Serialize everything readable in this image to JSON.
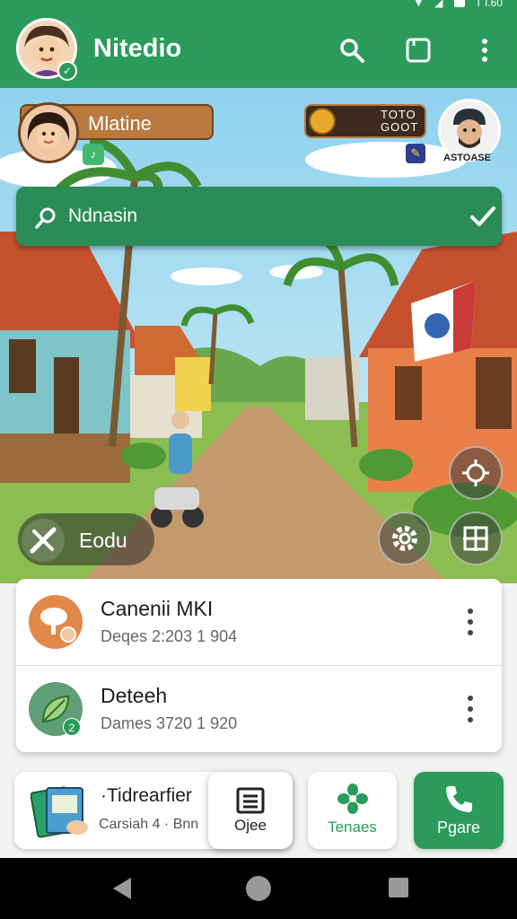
{
  "colors": {
    "brand": "#2b9b5c",
    "chip_brown": "#b9793f",
    "card_bg": "#ffffff"
  },
  "status_bar": {
    "time": "T I.60"
  },
  "app_bar": {
    "title": "Nitedio",
    "actions": [
      {
        "icon": "search-icon"
      },
      {
        "icon": "tab-icon"
      },
      {
        "icon": "more-vert-icon"
      }
    ]
  },
  "hero": {
    "user_chip": {
      "name": "Mlatine"
    },
    "score_chip": {
      "line1": "TOTO",
      "line2": "GOOT"
    },
    "right_avatar_tag": "ASTOASE",
    "search": {
      "value": "Ndnasin"
    },
    "edit_pill": {
      "label": "Eodu"
    }
  },
  "list": [
    {
      "title": "Canenii MKI",
      "subtitle": "Deqes 2:203  1  904",
      "icon": "tree-icon"
    },
    {
      "title": "Deteeh",
      "subtitle": "Dames 3720  1  920",
      "icon": "leaf-icon",
      "badge": "2"
    }
  ],
  "bottom": {
    "wide_card": {
      "title": "·Tidrearfier",
      "subtitle": "Carsiah 4 · Bnn"
    },
    "doc_card": {
      "label": "Ojee"
    },
    "tile_card": {
      "label": "Tenaes"
    },
    "phone_card": {
      "label": "Pgare"
    }
  }
}
